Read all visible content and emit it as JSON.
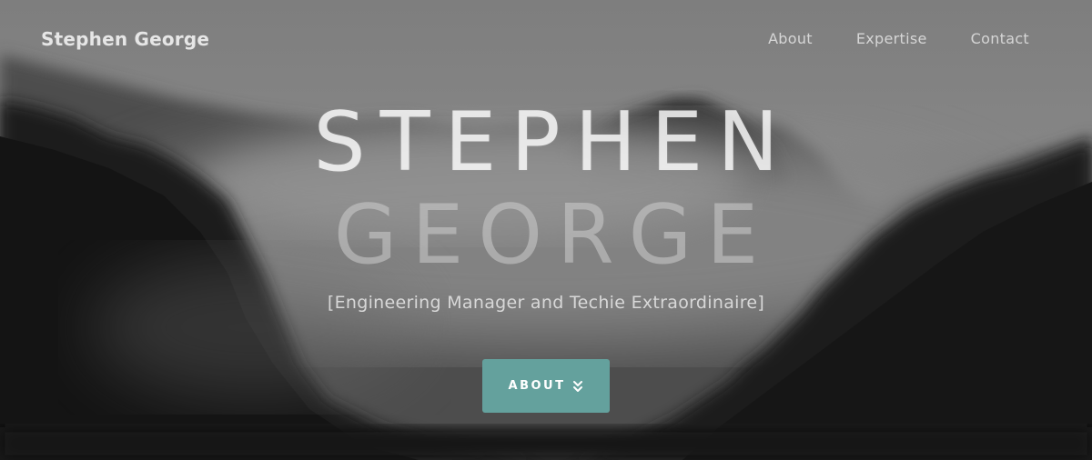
{
  "brand": "Stephen George",
  "nav": {
    "items": [
      {
        "label": "About"
      },
      {
        "label": "Expertise"
      },
      {
        "label": "Contact"
      }
    ]
  },
  "hero": {
    "title_line1": "STEPHEN",
    "title_line2": "GEORGE",
    "subtitle": "[Engineering Manager and Techie Extraordinaire]",
    "button_label": "ABOUT",
    "button_icon": "double-chevron-down-icon"
  },
  "colors": {
    "accent": "#64a19d",
    "text_light": "#e6e6e6"
  }
}
